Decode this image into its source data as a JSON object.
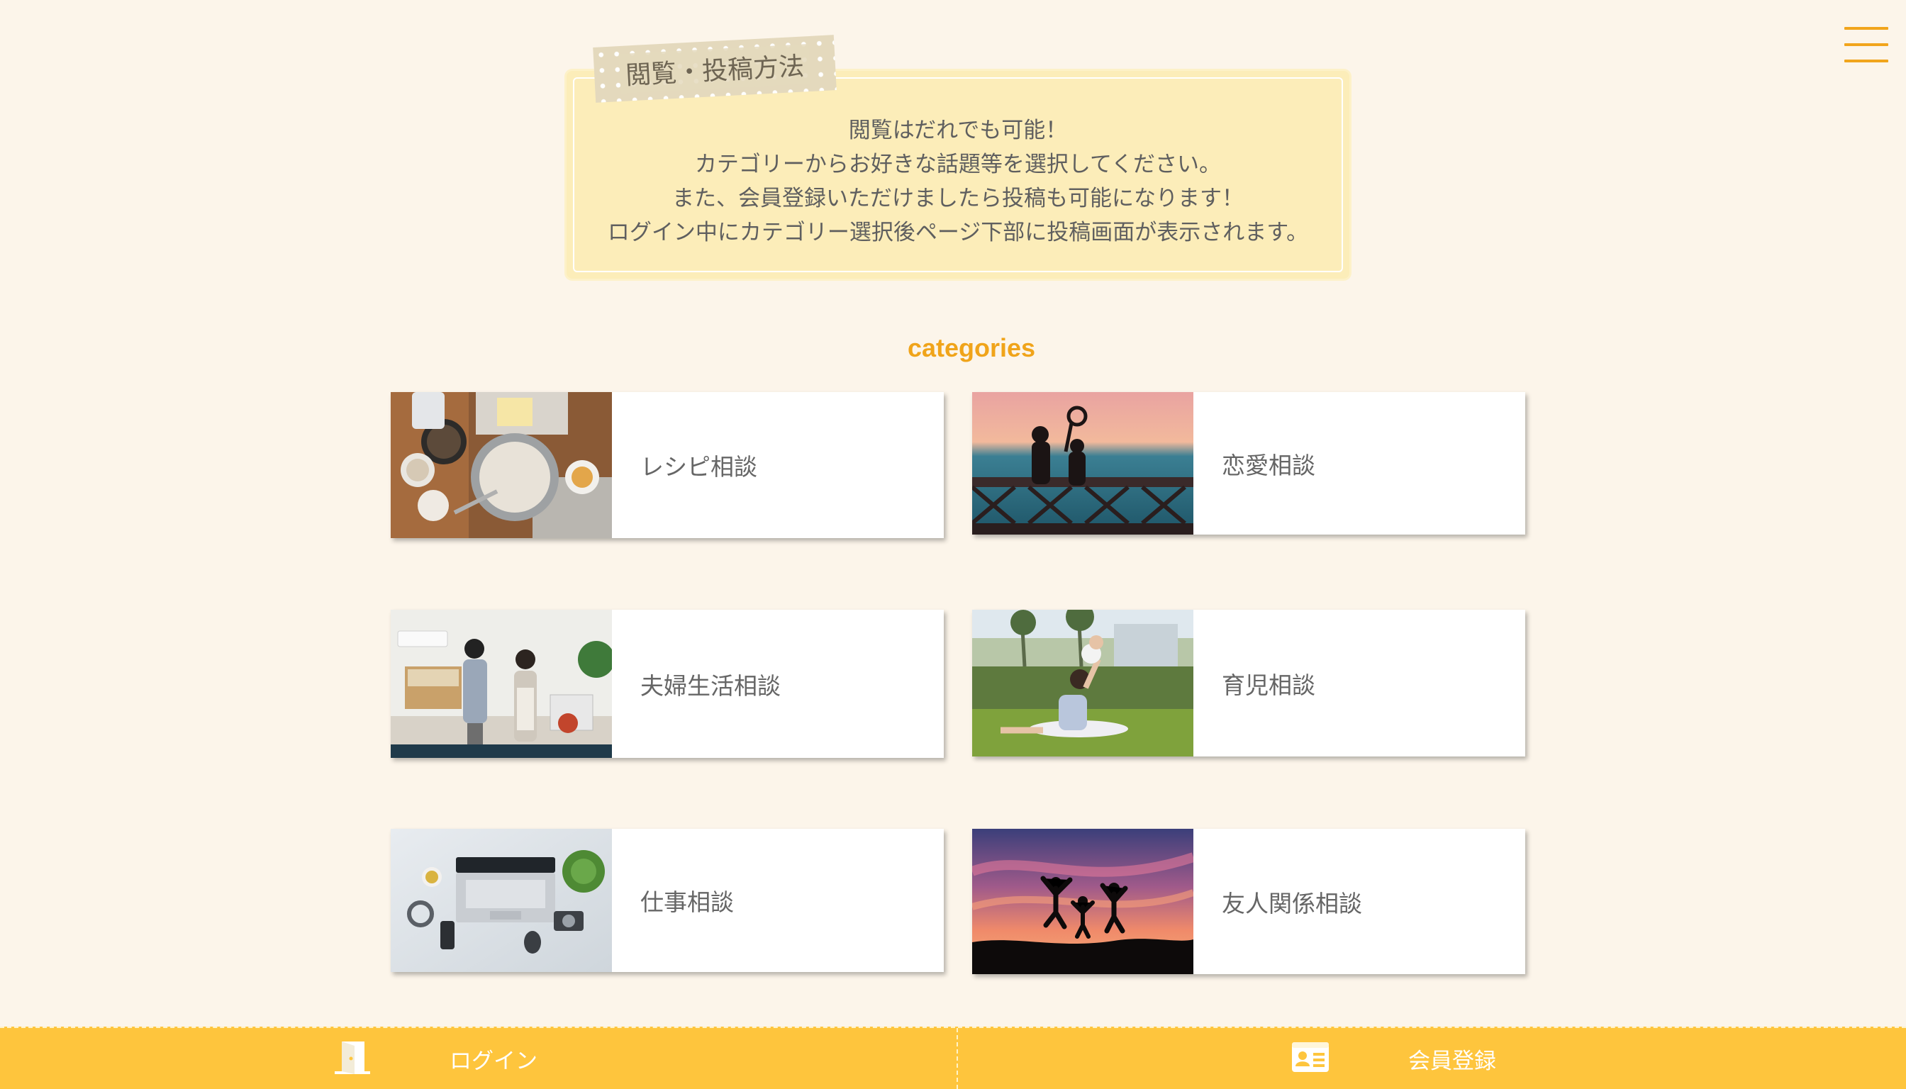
{
  "header": {
    "menu_icon": "hamburger-menu-icon"
  },
  "info": {
    "tag": "閲覧・投稿方法",
    "lines": [
      "閲覧はだれでも可能！",
      "カテゴリーからお好きな話題等を選択してください。",
      "また、会員登録いただけましたら投稿も可能になります！",
      "ログイン中にカテゴリー選択後ページ下部に投稿画面が表示されます。"
    ]
  },
  "categories": {
    "heading": "categories",
    "items": [
      {
        "label": "レシピ相談",
        "image": "cooking-photo"
      },
      {
        "label": "恋愛相談",
        "image": "couple-sunset-photo"
      },
      {
        "label": "夫婦生活相談",
        "image": "couple-kitchen-photo"
      },
      {
        "label": "育児相談",
        "image": "mother-child-park-photo"
      },
      {
        "label": "仕事相談",
        "image": "laptop-desk-photo"
      },
      {
        "label": "友人関係相談",
        "image": "friends-jumping-sunset-photo"
      }
    ]
  },
  "footer": {
    "login_label": "ログイン",
    "login_icon": "door-icon",
    "register_label": "会員登録",
    "register_icon": "id-card-icon"
  },
  "colors": {
    "background": "#fcf5ea",
    "accent": "#f0a41a",
    "info_box": "#fcedb9",
    "footer_bar": "#fec53d"
  }
}
